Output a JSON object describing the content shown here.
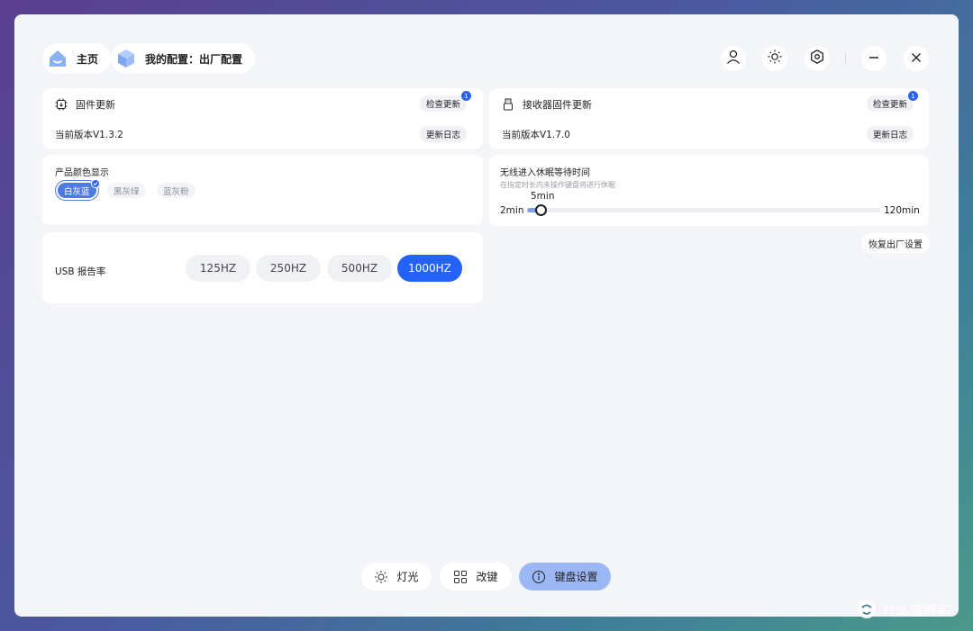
{
  "header": {
    "home_label": "主页",
    "config_label": "我的配置：出厂配置"
  },
  "firmware": {
    "title": "固件更新",
    "check_label": "检查更新",
    "badge": "1",
    "version": "当前版本V1.3.2",
    "log_label": "更新日志"
  },
  "receiver": {
    "title": "接收器固件更新",
    "check_label": "检查更新",
    "badge": "1",
    "version": "当前版本V1.7.0",
    "log_label": "更新日志"
  },
  "color_display": {
    "title": "产品颜色显示",
    "options": [
      "白灰蓝",
      "黑灰绿",
      "蓝灰粉"
    ],
    "selected": "白灰蓝"
  },
  "sleep": {
    "title": "无线进入休眠等待时间",
    "subtitle": "在指定时长内未操作键盘将进行休眠",
    "min_label": "2min",
    "max_label": "120min",
    "current_label": "5min",
    "value_fraction": 0.026
  },
  "factory_reset_label": "恢复出厂设置",
  "usb_rate": {
    "label": "USB 报告率",
    "options": [
      "125HZ",
      "250HZ",
      "500HZ",
      "1000HZ"
    ],
    "selected": "1000HZ"
  },
  "bottom_nav": {
    "light": "灯光",
    "remap": "改键",
    "keyboard_settings": "键盘设置",
    "active": "键盘设置"
  },
  "watermark": "什么值得买",
  "colors": {
    "accent": "#2262f5",
    "chip_selected": "#4f7be0",
    "nav_active": "#9bb7f6",
    "badge": "#2a62f4"
  }
}
